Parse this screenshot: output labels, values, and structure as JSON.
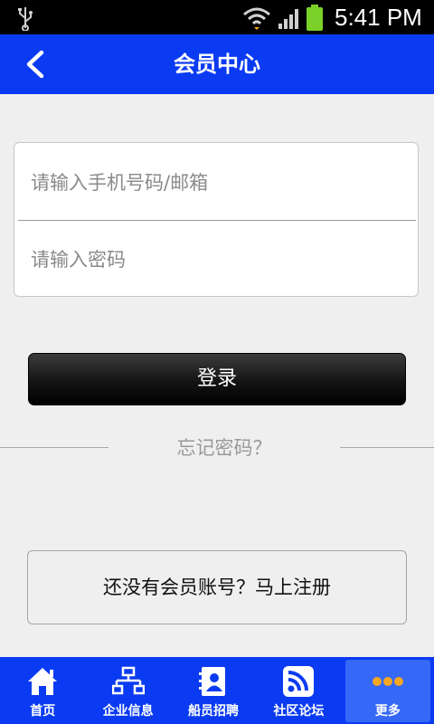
{
  "status_bar": {
    "time": "5:41 PM"
  },
  "header": {
    "title": "会员中心"
  },
  "login_form": {
    "account_placeholder": "请输入手机号码/邮箱",
    "password_placeholder": "请输入密码"
  },
  "login_button_label": "登录",
  "forgot_password_label": "忘记密码？",
  "register_label": "还没有会员账号？马上注册",
  "tab_bar": {
    "items": [
      {
        "label": "首页",
        "icon": "home-icon"
      },
      {
        "label": "企业信息",
        "icon": "org-chart-icon"
      },
      {
        "label": "船员招聘",
        "icon": "contacts-icon"
      },
      {
        "label": "社区论坛",
        "icon": "rss-icon"
      },
      {
        "label": "更多",
        "icon": "more-icon"
      }
    ],
    "active_index": 4
  },
  "colors": {
    "primary": "#0a3bf2",
    "active_tab": "#3568f6",
    "more_dots": "#f5a623"
  }
}
